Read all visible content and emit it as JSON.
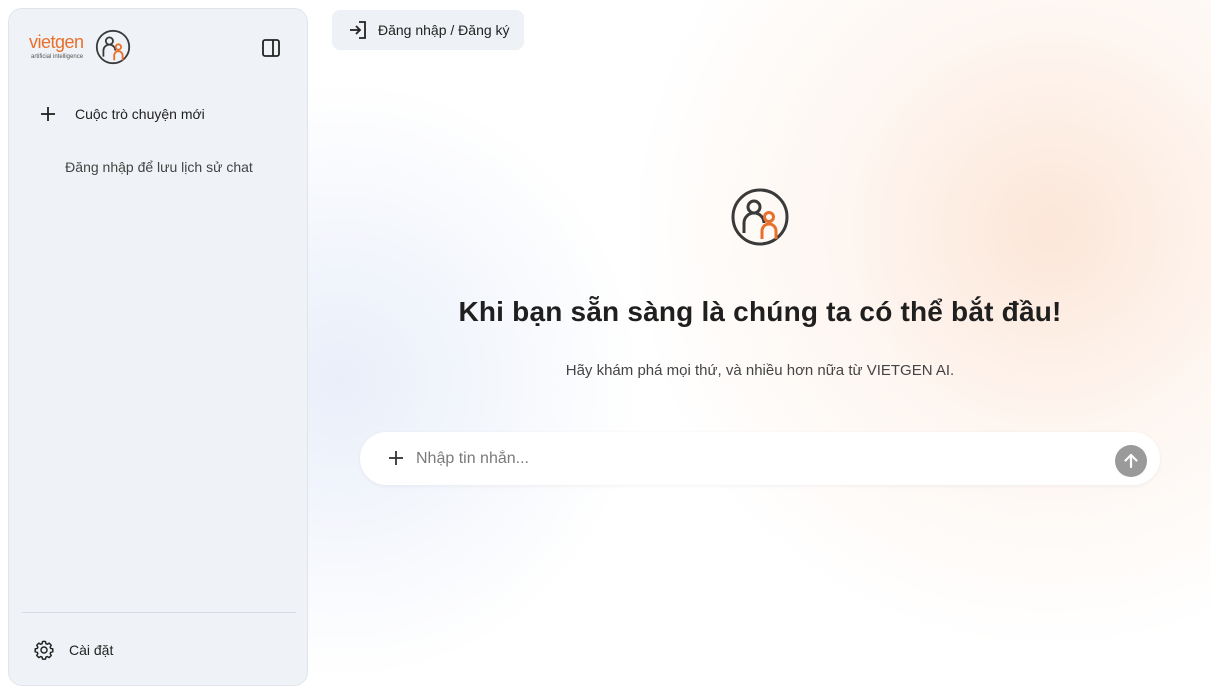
{
  "sidebar": {
    "logo": {
      "wordmark": "vietgen",
      "tagline": "artificial intelligence"
    },
    "new_chat_label": "Cuộc trò chuyện mới",
    "login_hint": "Đăng nhập để lưu lịch sử chat",
    "settings_label": "Cài đặt"
  },
  "header": {
    "login_label": "Đăng nhập / Đăng ký"
  },
  "main": {
    "headline": "Khi bạn sẵn sàng là chúng ta có thể bắt đầu!",
    "subline": "Hãy khám phá mọi thứ, và nhiều hơn nữa từ VIETGEN AI.",
    "composer": {
      "placeholder": "Nhập tin nhắn..."
    }
  },
  "colors": {
    "brand_orange": "#e8702a",
    "sidebar_bg": "#eff2f6",
    "send_button": "#9a9a9a"
  },
  "icons": {
    "collapse": "sidebar-toggle-icon",
    "new_chat": "plus-icon",
    "settings": "gear-icon",
    "login": "login-arrow-icon",
    "attach": "plus-icon",
    "send": "arrow-up-icon",
    "brand": "vietgen-person-icon"
  }
}
